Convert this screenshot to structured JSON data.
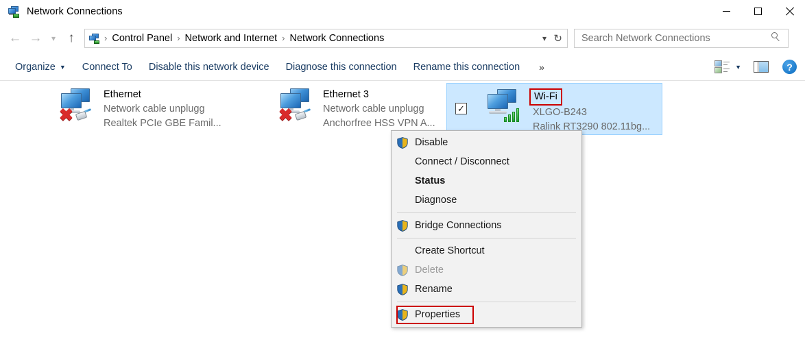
{
  "window": {
    "title": "Network Connections",
    "icon": "network-connections-icon",
    "controls": {
      "minimize": "minimize-icon",
      "maximize": "maximize-icon",
      "close": "close-icon"
    }
  },
  "address_bar": {
    "back": "back-arrow-icon",
    "forward": "forward-arrow-icon",
    "history": "recent-locations-chevron-icon",
    "up": "up-arrow-icon",
    "breadcrumbs": [
      "Control Panel",
      "Network and Internet",
      "Network Connections"
    ],
    "separator": "›",
    "dropdown": "address-dropdown-chevron",
    "refresh": "refresh-icon"
  },
  "search": {
    "placeholder": "Search Network Connections",
    "icon": "search-icon"
  },
  "command_bar": {
    "items": [
      {
        "label": "Organize",
        "has_caret": true
      },
      {
        "label": "Connect To",
        "has_caret": false
      },
      {
        "label": "Disable this network device",
        "has_caret": false
      },
      {
        "label": "Diagnose this connection",
        "has_caret": false
      },
      {
        "label": "Rename this connection",
        "has_caret": false
      }
    ],
    "overflow": "»",
    "view_icon": "change-view-icon",
    "view_dropdown": "change-view-dropdown-caret",
    "preview_pane_icon": "preview-pane-icon",
    "help_icon": "help-icon",
    "help_label": "?"
  },
  "connections": [
    {
      "name": "Ethernet",
      "status": "Network cable unplugg",
      "device": "Realtek PCIe GBE Famil...",
      "icon": "network-adapter-disconnected-icon",
      "selected": false,
      "checked": false,
      "highlight_name": false,
      "signal": false,
      "error": true
    },
    {
      "name": "Ethernet 3",
      "status": "Network cable unplugg",
      "device": "Anchorfree HSS VPN A...",
      "icon": "network-adapter-disconnected-icon",
      "selected": false,
      "checked": false,
      "highlight_name": false,
      "signal": false,
      "error": true
    },
    {
      "name": "Wi-Fi",
      "status": "XLGO-B243",
      "device": "Ralink RT3290 802.11bg...",
      "icon": "wireless-adapter-connected-icon",
      "selected": true,
      "checked": true,
      "highlight_name": true,
      "signal": true,
      "error": false
    }
  ],
  "context_menu": {
    "items": [
      {
        "label": "Disable",
        "shield": true,
        "bold": false,
        "disabled": false,
        "highlighted": false,
        "separator_after": false
      },
      {
        "label": "Connect / Disconnect",
        "shield": false,
        "bold": false,
        "disabled": false,
        "highlighted": false,
        "separator_after": false
      },
      {
        "label": "Status",
        "shield": false,
        "bold": true,
        "disabled": false,
        "highlighted": false,
        "separator_after": false
      },
      {
        "label": "Diagnose",
        "shield": false,
        "bold": false,
        "disabled": false,
        "highlighted": false,
        "separator_after": true
      },
      {
        "label": "Bridge Connections",
        "shield": true,
        "bold": false,
        "disabled": false,
        "highlighted": false,
        "separator_after": true
      },
      {
        "label": "Create Shortcut",
        "shield": false,
        "bold": false,
        "disabled": false,
        "highlighted": false,
        "separator_after": false
      },
      {
        "label": "Delete",
        "shield": true,
        "bold": false,
        "disabled": true,
        "highlighted": false,
        "separator_after": false
      },
      {
        "label": "Rename",
        "shield": true,
        "bold": false,
        "disabled": false,
        "highlighted": false,
        "separator_after": true
      },
      {
        "label": "Properties",
        "shield": true,
        "bold": false,
        "disabled": false,
        "highlighted": true,
        "separator_after": false
      }
    ]
  },
  "colors": {
    "selection_fill": "#cce8ff",
    "selection_border": "#99d1ff",
    "annotation_red": "#cc0000",
    "command_link": "#1a3c63",
    "menu_background": "#f2f2f2",
    "subtext": "#6b6b6b"
  }
}
